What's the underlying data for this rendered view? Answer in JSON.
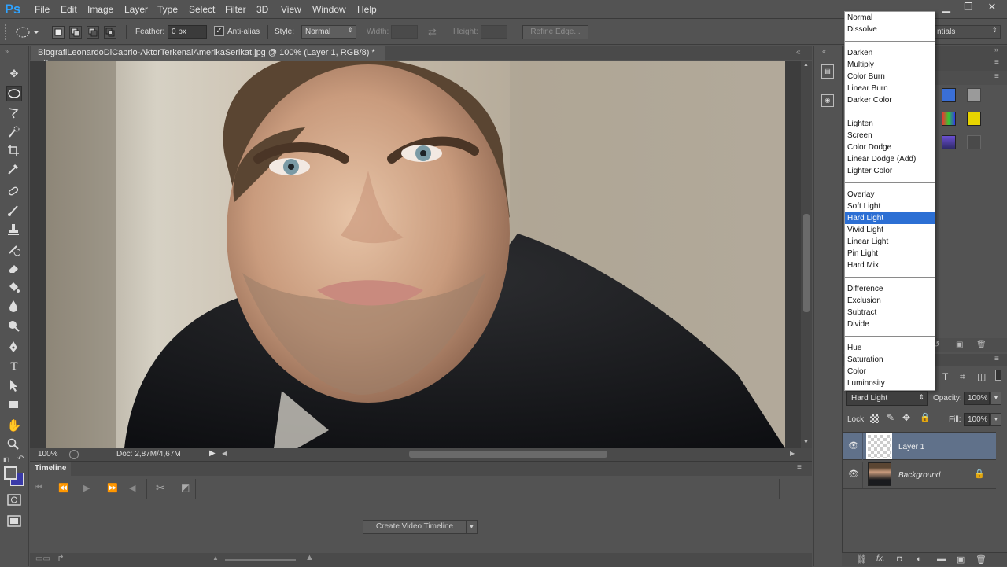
{
  "app": {
    "logo": "Ps"
  },
  "menu": [
    "File",
    "Edit",
    "Image",
    "Layer",
    "Type",
    "Select",
    "Filter",
    "3D",
    "View",
    "Window",
    "Help"
  ],
  "window_controls": {
    "minimize": "▁",
    "restore": "❐",
    "close": "✕"
  },
  "options": {
    "feather_label": "Feather:",
    "feather_value": "0 px",
    "antialias_label": "Anti-alias",
    "antialias_checked": true,
    "style_label": "Style:",
    "style_value": "Normal",
    "width_label": "Width:",
    "height_label": "Height:",
    "refine_edge": "Refine Edge...",
    "workspace_value": "ntials"
  },
  "document": {
    "tab_title": "BiografiLeonardoDiCaprio-AktorTerkenalAmerikaSerikat.jpg @ 100% (Layer 1, RGB/8) *",
    "close": "×",
    "zoom": "100%",
    "doc_info": "Doc: 2,87M/4,67M"
  },
  "timeline": {
    "title": "Timeline",
    "create_button": "Create Video Timeline"
  },
  "blend_modes": {
    "groups": [
      [
        "Normal",
        "Dissolve"
      ],
      [
        "Darken",
        "Multiply",
        "Color Burn",
        "Linear Burn",
        "Darker Color"
      ],
      [
        "Lighten",
        "Screen",
        "Color Dodge",
        "Linear Dodge (Add)",
        "Lighter Color"
      ],
      [
        "Overlay",
        "Soft Light",
        "Hard Light",
        "Vivid Light",
        "Linear Light",
        "Pin Light",
        "Hard Mix"
      ],
      [
        "Difference",
        "Exclusion",
        "Subtract",
        "Divide"
      ],
      [
        "Hue",
        "Saturation",
        "Color",
        "Luminosity"
      ]
    ],
    "selected": "Hard Light"
  },
  "layers_panel": {
    "blend_value": "Hard Light",
    "opacity_label": "Opacity:",
    "opacity_value": "100%",
    "lock_label": "Lock:",
    "fill_label": "Fill:",
    "fill_value": "100%",
    "layers": [
      {
        "name": "Layer 1",
        "selected": true
      },
      {
        "name": "Background",
        "locked": true
      }
    ]
  },
  "colors": {
    "accent": "#2c6fd4",
    "panel": "#535353",
    "selected_layer": "#60718a"
  }
}
